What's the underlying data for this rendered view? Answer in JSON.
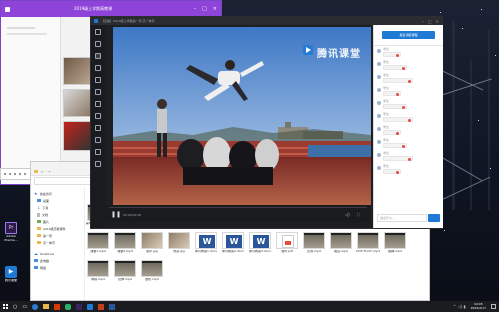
{
  "purple_window": {
    "title": "2019级上学期高教课"
  },
  "player": {
    "title": "【直播】2019级上学期第一周 高一体育",
    "brand": "腾讯课堂",
    "time": "00:00/02:00",
    "side_button": "报名领取课程",
    "chat": [
      {
        "label": "学生"
      },
      {
        "label": "学生"
      },
      {
        "label": "学生"
      },
      {
        "label": "学生"
      },
      {
        "label": "学生"
      },
      {
        "label": "学生"
      },
      {
        "label": "学生"
      },
      {
        "label": "学生"
      },
      {
        "label": "学生"
      },
      {
        "label": "学生"
      }
    ],
    "chat_placeholder": "说点什么..."
  },
  "explorer": {
    "sidebar": [
      "快速访问",
      "桌面",
      "下载",
      "文档",
      "图片",
      "2019级高教课件",
      "第一周",
      "高一体育",
      "OneDrive",
      "此电脑",
      "网络"
    ]
  },
  "files": [
    {
      "name": "第8周体育课.mp4",
      "kind": "video"
    },
    {
      "name": "vid_001.mp4",
      "kind": "video"
    },
    {
      "name": "lesson.mp4",
      "kind": "video"
    },
    {
      "name": "VID20200115.mp4",
      "kind": "video"
    },
    {
      "name": "体育.jpg",
      "kind": "photo"
    },
    {
      "name": "体育课教案.docx",
      "kind": "word"
    },
    {
      "name": "高一课程表.png",
      "kind": "grid"
    },
    {
      "name": "跳跃练习.mp4",
      "kind": "video"
    },
    {
      "name": "训练1.mp4",
      "kind": "video"
    },
    {
      "name": "训练2.mp4",
      "kind": "video"
    },
    {
      "name": "训练3.mp4",
      "kind": "video"
    },
    {
      "name": "操场.mp4",
      "kind": "video"
    },
    {
      "name": "课堂1.mp4",
      "kind": "video"
    },
    {
      "name": "课堂2.mp4",
      "kind": "video"
    },
    {
      "name": "跑步.jpg",
      "kind": "photo"
    },
    {
      "name": "热身.jpg",
      "kind": "photo"
    },
    {
      "name": "体育教案1.docx",
      "kind": "word"
    },
    {
      "name": "体育教案2.docx",
      "kind": "word"
    },
    {
      "name": "体育教案3.docx",
      "kind": "word"
    },
    {
      "name": "课件.pdf",
      "kind": "pdf"
    },
    {
      "name": "比赛.mp4",
      "kind": "video"
    },
    {
      "name": "跳远.mp4",
      "kind": "video"
    },
    {
      "name": "DCE\"Fulld\".mp4",
      "kind": "video"
    },
    {
      "name": "跳绳.mp4",
      "kind": "video"
    },
    {
      "name": "体操.mp4",
      "kind": "video"
    },
    {
      "name": "拉伸.mp4",
      "kind": "video"
    },
    {
      "name": "放松.mp4",
      "kind": "video"
    }
  ],
  "desktop_icons": [
    {
      "label": "Adobe Premie..."
    },
    {
      "label": "腾讯课堂"
    }
  ],
  "taskbar": {
    "time": "19:05",
    "date": "2020/2/17"
  }
}
